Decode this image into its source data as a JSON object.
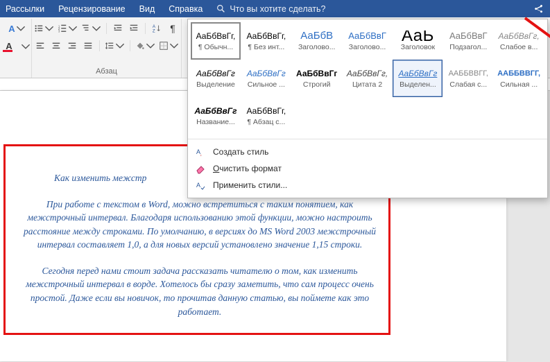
{
  "menubar": {
    "items": [
      "Рассылки",
      "Рецензирование",
      "Вид",
      "Справка"
    ],
    "search_label": "Что вы хотите сделать?"
  },
  "ribbon": {
    "paragraph_label": "Абзац"
  },
  "styles": {
    "cells": [
      {
        "sample": "АаБбВвГг,",
        "label": "¶ Обычн...",
        "sample_style": "color:#000;font-size:12px;",
        "selected2": true
      },
      {
        "sample": "АаБбВвГг,",
        "label": "¶ Без инт...",
        "sample_style": "color:#000;font-size:12px;"
      },
      {
        "sample": "АаБбВ",
        "label": "Заголово...",
        "sample_style": "color:#2e6fc4;font-size:15px;"
      },
      {
        "sample": "АаБбВвГ",
        "label": "Заголово...",
        "sample_style": "color:#2e6fc4;font-size:13px;"
      },
      {
        "sample": "АаЬ",
        "label": "Заголовок",
        "sample_style": "color:#000;font-size:24px;font-weight:300;letter-spacing:.5px;"
      },
      {
        "sample": "АаБбВвГ",
        "label": "Подзагол...",
        "sample_style": "color:#7b7b7b;font-size:13px;"
      },
      {
        "sample": "АаБбВвГг,",
        "label": "Слабое в...",
        "sample_style": "color:#888;font-style:italic;font-size:12px;"
      },
      {
        "sample": "АаБбВвГг",
        "label": "Выделение",
        "sample_style": "color:#000;font-style:italic;font-size:12px;"
      },
      {
        "sample": "АаБбВвГг",
        "label": "Сильное ...",
        "sample_style": "color:#2e6fc4;font-style:italic;font-size:12px;"
      },
      {
        "sample": "АаБбВвГг",
        "label": "Строгий",
        "sample_style": "color:#000;font-weight:bold;font-size:12px;"
      },
      {
        "sample": "АаБбВвГг,",
        "label": "Цитата 2",
        "sample_style": "color:#444;font-style:italic;font-size:12px;"
      },
      {
        "sample": "АаБбВвГг",
        "label": "Выделен...",
        "sample_style": "color:#2e6fc4;font-style:italic;font-size:12px;text-decoration:underline;",
        "selected": true
      },
      {
        "sample": "ААББВВГГ,",
        "label": "Слабая с...",
        "sample_style": "color:#888;font-size:11px;"
      },
      {
        "sample": "ААББВВГГ,",
        "label": "Сильная ...",
        "sample_style": "color:#2e6fc4;font-size:11px;font-weight:bold;"
      },
      {
        "sample": "АаБбВвГг",
        "label": "Название...",
        "sample_style": "color:#000;font-weight:bold;font-style:italic;font-size:12px;"
      },
      {
        "sample": "АаБбВвГг,",
        "label": "¶ Абзац с...",
        "sample_style": "color:#000;font-size:12px;"
      }
    ],
    "menu": {
      "create": "Создать стиль",
      "clear": "Очистить формат",
      "apply": "Применить стили..."
    }
  },
  "document": {
    "title_fragment": "Как изменить межстр",
    "para1": "При работе с текстом в Word, можно встретиться с таким понятием, как межстрочный интервал. Благодаря использованию этой функции, можно настроить расстояние между строками. По умолчанию, в версиях до MS Word 2003 межстрочный интервал составляет 1,0, а для новых версий установлено значение 1,15 строки.",
    "para2": "Сегодня перед нами стоит задача рассказать читателю о том, как изменить межстрочный интервал в ворде. Хотелось бы сразу заметить, что сам процесс очень простой. Даже если вы новичок, то прочитав данную статью, вы поймете как это работает."
  }
}
